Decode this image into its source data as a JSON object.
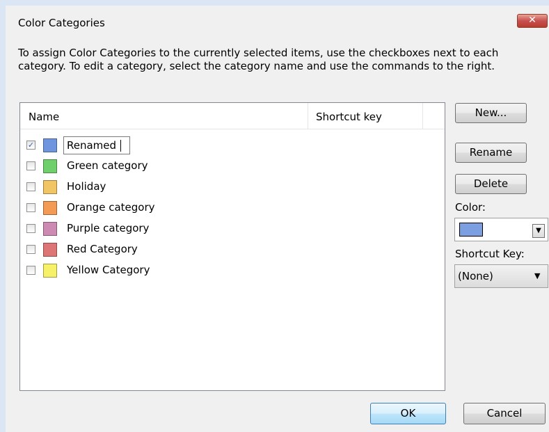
{
  "dialog": {
    "title": "Color Categories",
    "close_glyph": "✕",
    "description": "To assign Color Categories to the currently selected items, use the checkboxes next to each category.  To edit a category, select the category name and use the commands to the right."
  },
  "list": {
    "columns": {
      "name": "Name",
      "shortcut": "Shortcut key"
    },
    "items": [
      {
        "name": "Renamed",
        "checked": true,
        "color": "#6f95de",
        "editing": true
      },
      {
        "name": "Green category",
        "checked": false,
        "color": "#6fcf6a"
      },
      {
        "name": "Holiday",
        "checked": false,
        "color": "#f1c563"
      },
      {
        "name": "Orange category",
        "checked": false,
        "color": "#f39a55"
      },
      {
        "name": "Purple category",
        "checked": false,
        "color": "#cd8bb3"
      },
      {
        "name": "Red Category",
        "checked": false,
        "color": "#dd7476"
      },
      {
        "name": "Yellow Category",
        "checked": false,
        "color": "#f7f16a"
      }
    ]
  },
  "buttons": {
    "new": "New...",
    "rename": "Rename",
    "delete": "Delete",
    "ok": "OK",
    "cancel": "Cancel"
  },
  "color": {
    "label": "Color:",
    "value": "#7b9fe0"
  },
  "shortcut": {
    "label": "Shortcut Key:",
    "value": "(None)"
  },
  "icons": {
    "checkmark": "✓",
    "dropdown": "▼"
  }
}
